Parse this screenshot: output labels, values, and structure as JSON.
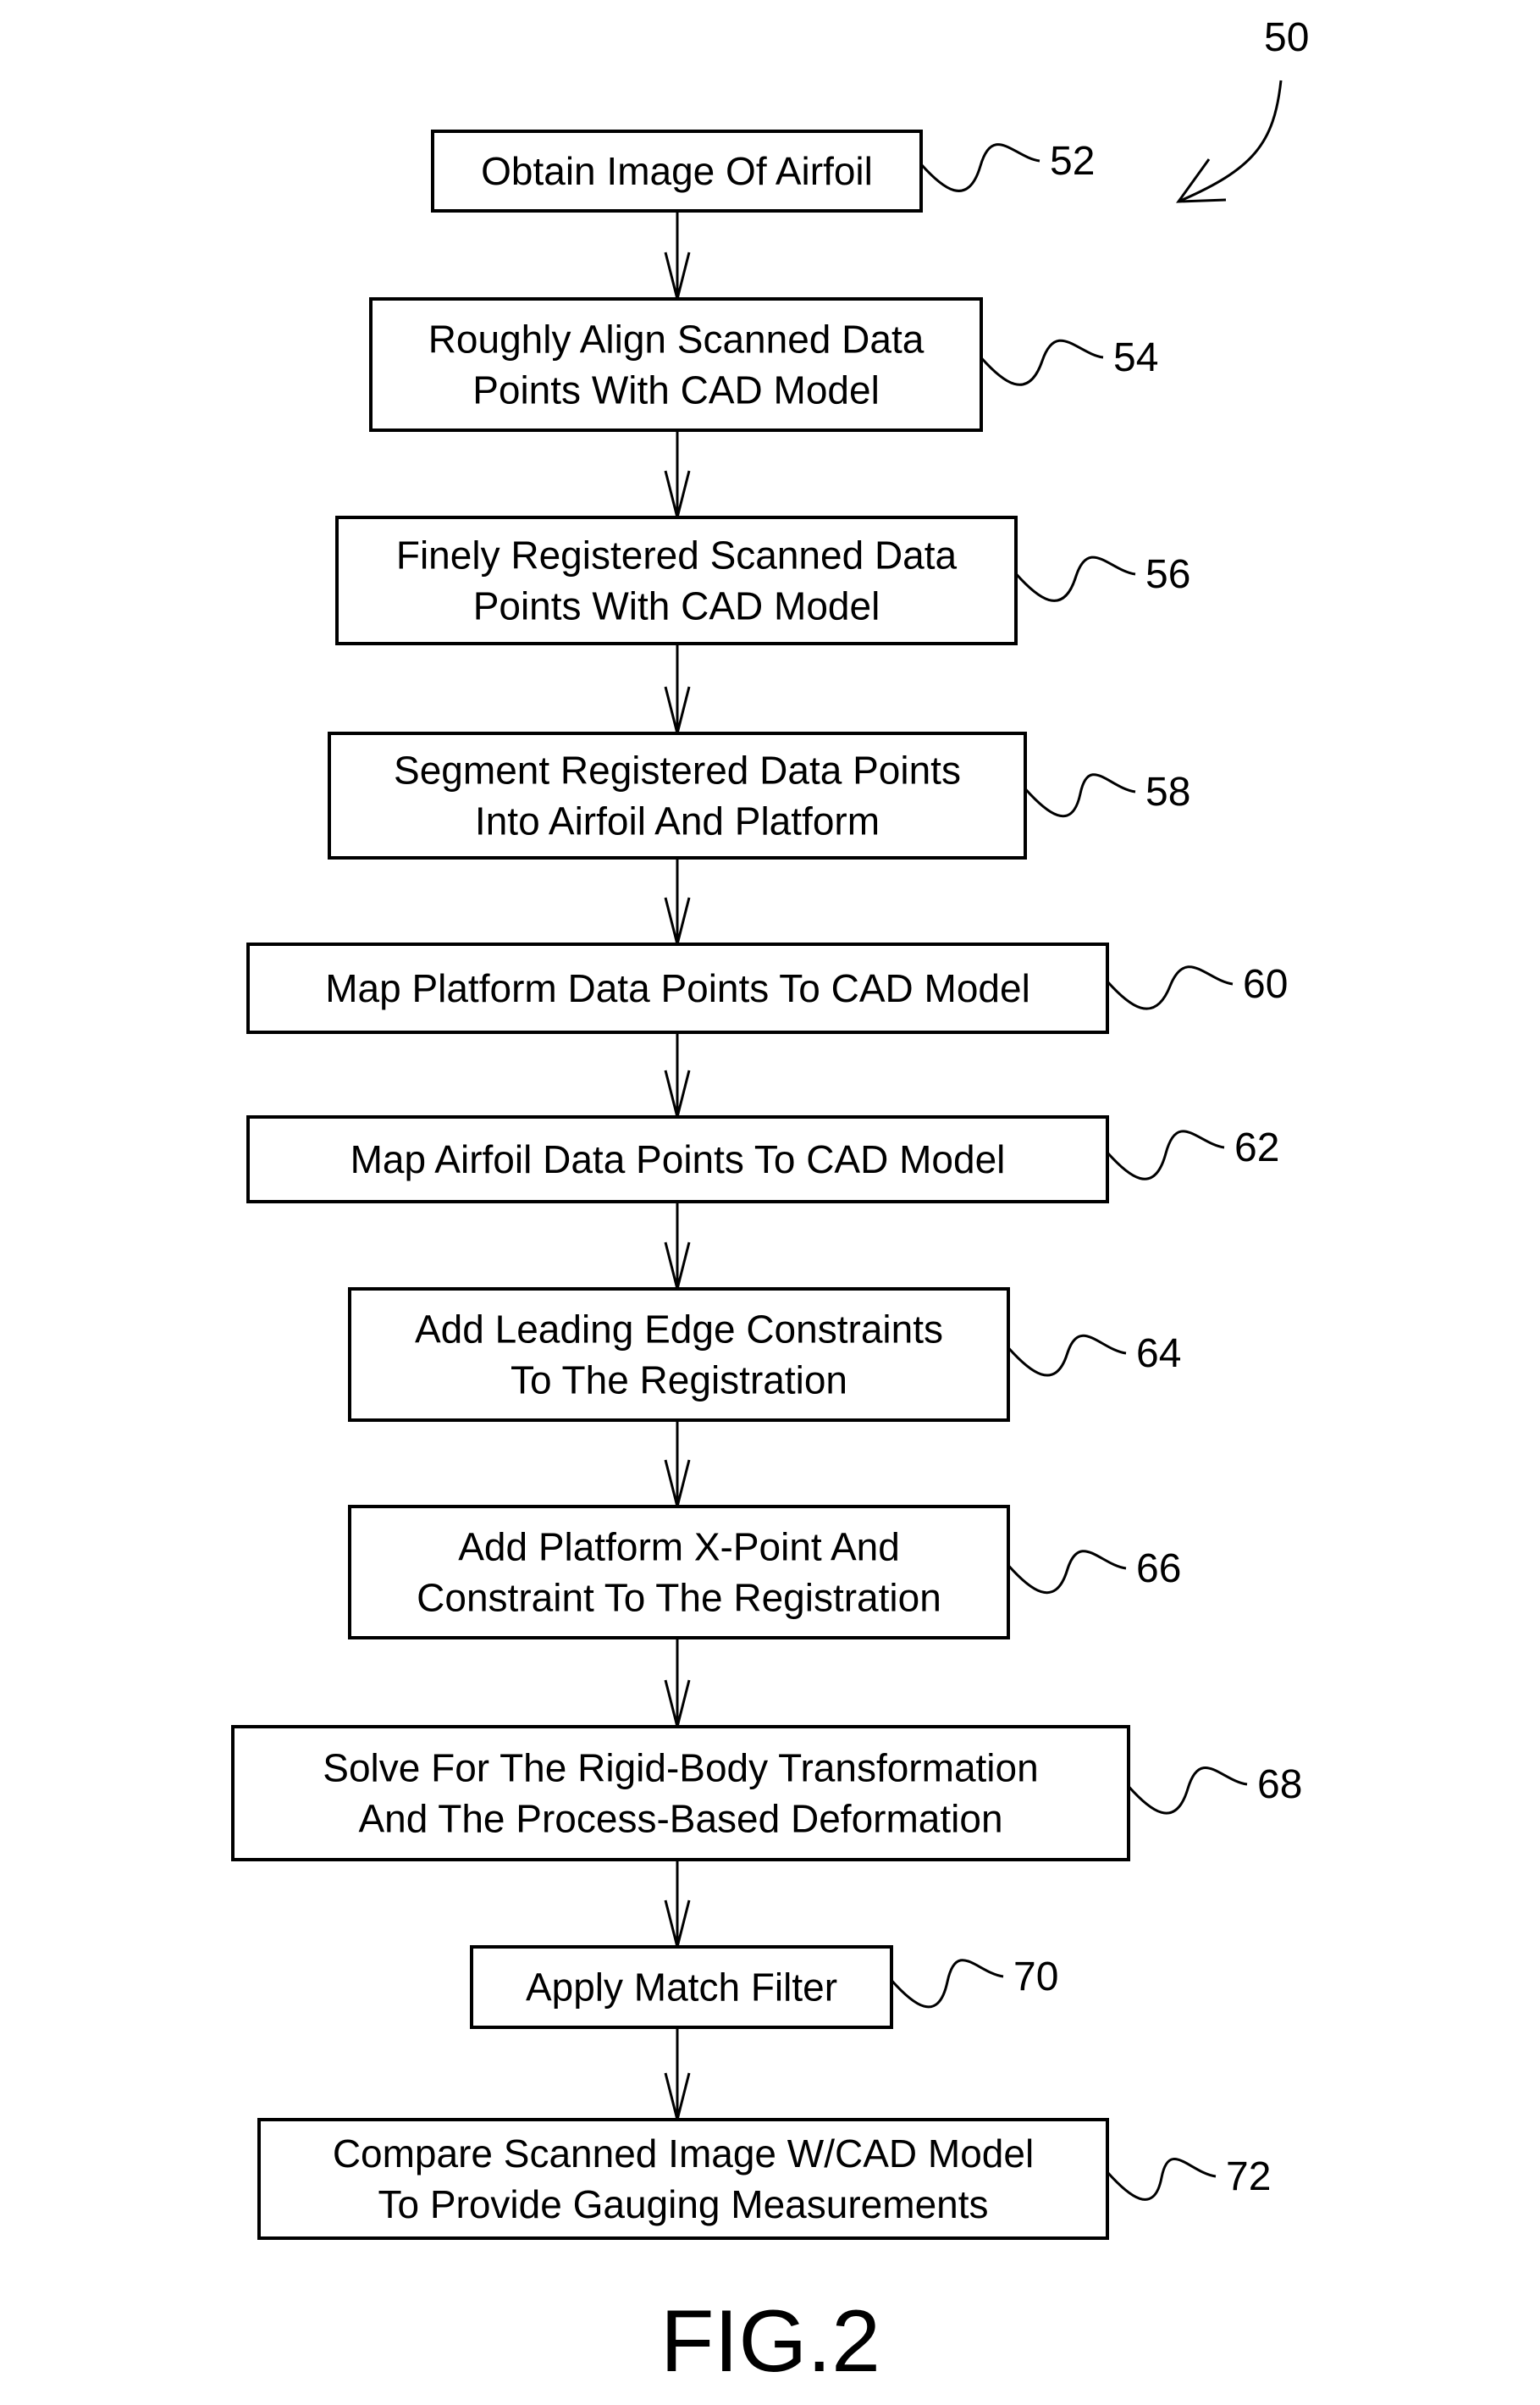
{
  "figure": {
    "label": "FIG.2",
    "reference": "50"
  },
  "steps": [
    {
      "ref": "52",
      "lines": [
        "Obtain Image Of Airfoil"
      ]
    },
    {
      "ref": "54",
      "lines": [
        "Roughly Align Scanned Data",
        "Points With CAD Model"
      ]
    },
    {
      "ref": "56",
      "lines": [
        "Finely Registered Scanned Data",
        "Points With CAD Model"
      ]
    },
    {
      "ref": "58",
      "lines": [
        "Segment Registered Data Points",
        "Into Airfoil And Platform"
      ]
    },
    {
      "ref": "60",
      "lines": [
        "Map Platform Data Points To CAD Model"
      ]
    },
    {
      "ref": "62",
      "lines": [
        "Map Airfoil Data Points To CAD Model"
      ]
    },
    {
      "ref": "64",
      "lines": [
        "Add Leading Edge Constraints",
        "To The Registration"
      ]
    },
    {
      "ref": "66",
      "lines": [
        "Add Platform X-Point And",
        "Constraint To The Registration"
      ]
    },
    {
      "ref": "68",
      "lines": [
        "Solve For The Rigid-Body Transformation",
        "And The Process-Based Deformation"
      ]
    },
    {
      "ref": "70",
      "lines": [
        "Apply Match Filter"
      ]
    },
    {
      "ref": "72",
      "lines": [
        "Compare Scanned Image W/CAD Model",
        "To Provide Gauging Measurements"
      ]
    }
  ]
}
